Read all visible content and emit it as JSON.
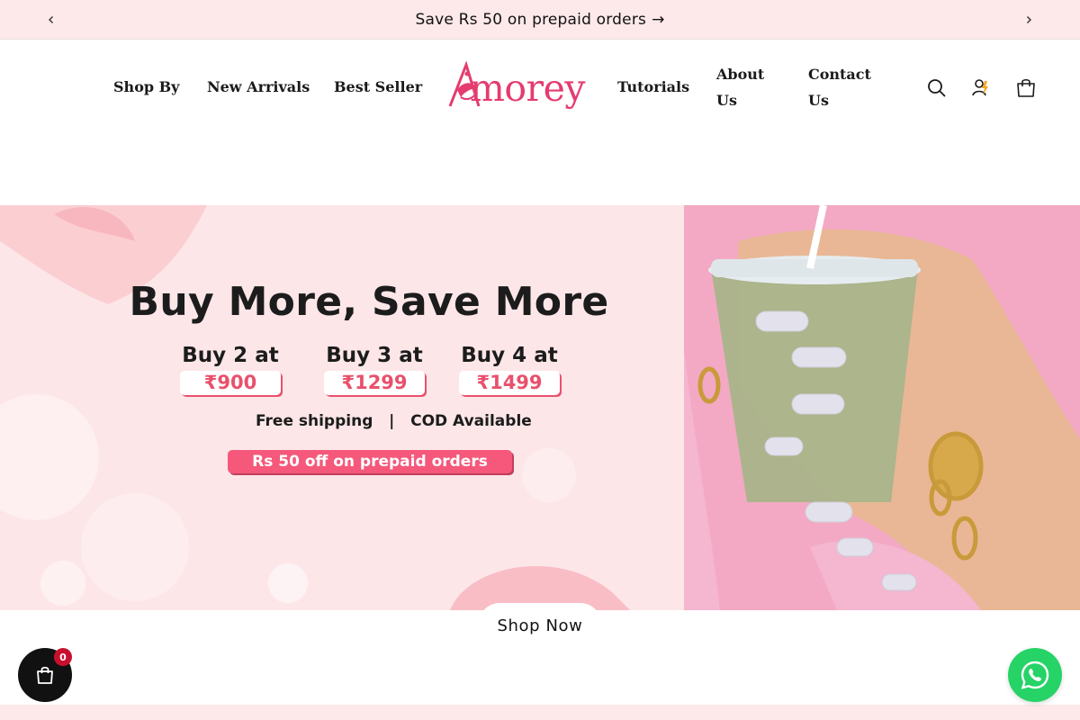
{
  "announcement": {
    "text": "Save Rs 50 on prepaid orders",
    "arrow": "→"
  },
  "nav": {
    "shop_by": "Shop By",
    "new_arrivals": "New Arrivals",
    "best_seller": "Best Seller",
    "tutorials": "Tutorials",
    "about_line1": "About",
    "about_line2": "Us",
    "contact_line1": "Contact",
    "contact_line2": "Us"
  },
  "logo": {
    "text": "morey"
  },
  "header_icons": [
    "search-icon",
    "account-icon",
    "cart-icon"
  ],
  "hero": {
    "title": "Buy More, Save More",
    "offers": [
      {
        "label": "Buy 2 at",
        "price": "₹900"
      },
      {
        "label": "Buy 3 at",
        "price": "₹1299"
      },
      {
        "label": "Buy 4 at",
        "price": "₹1499"
      }
    ],
    "info": "Free shipping   |   COD Available",
    "promo": "Rs 50 off on prepaid orders"
  },
  "shop_now": "Shop Now",
  "floating_cart": {
    "count": "0"
  },
  "colors": {
    "brand_pink": "#e43c6f",
    "announcement_bg": "#fde8ea",
    "promo_bg": "#f5587a",
    "whatsapp_green": "#25d366"
  }
}
